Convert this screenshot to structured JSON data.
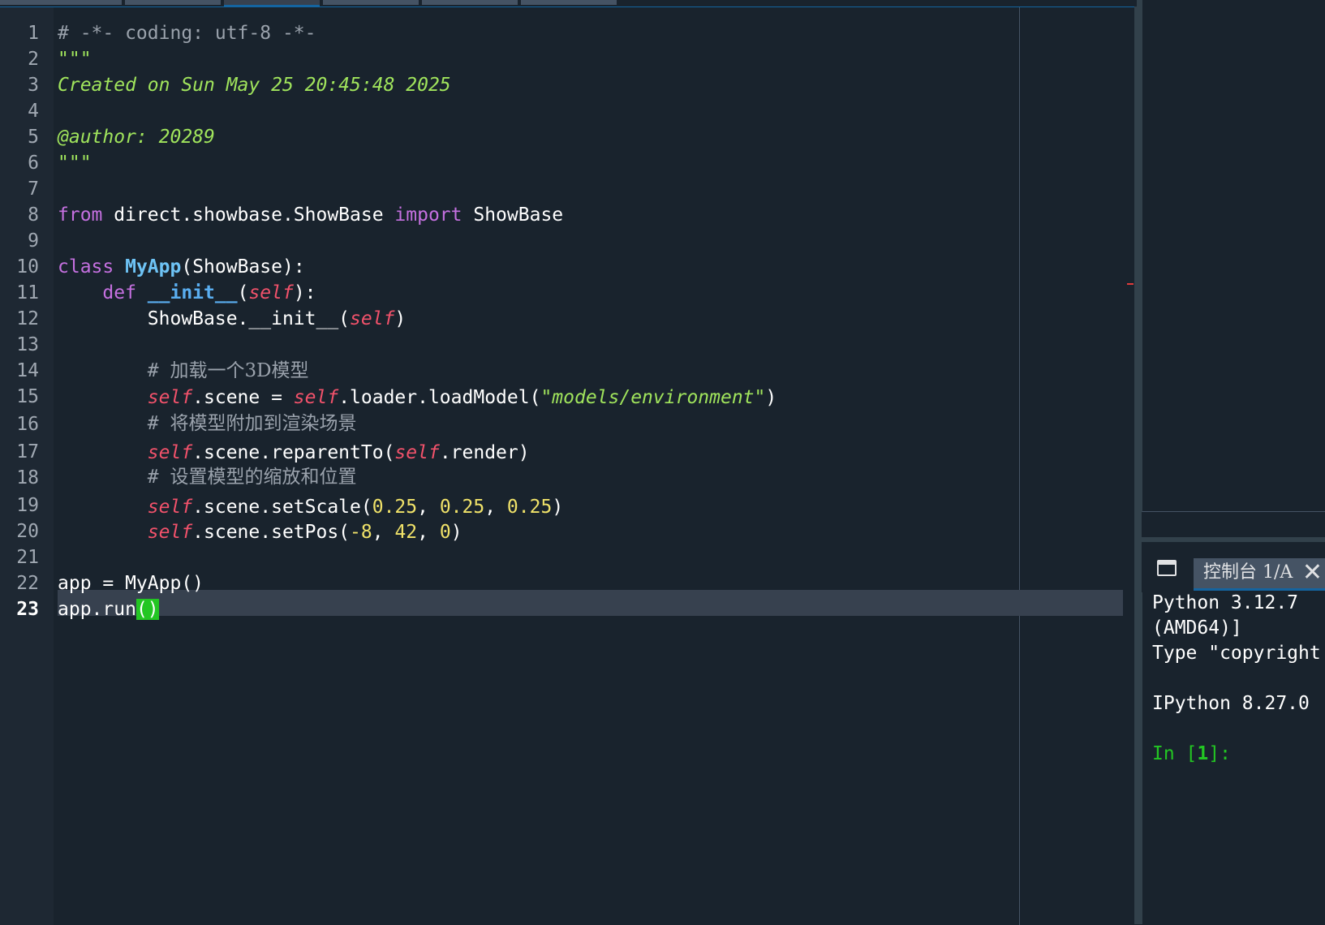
{
  "editor": {
    "current_line": 23,
    "line_numbers": [
      "1",
      "2",
      "3",
      "4",
      "5",
      "6",
      "7",
      "8",
      "9",
      "10",
      "11",
      "12",
      "13",
      "14",
      "15",
      "16",
      "17",
      "18",
      "19",
      "20",
      "21",
      "22",
      "23"
    ],
    "lines": {
      "l1": "# -*- coding: utf-8 -*-",
      "l2": "\"\"\"",
      "l3": "Created on Sun May 25 20:45:48 2025",
      "l4": "",
      "l5": "@author: 20289",
      "l6": "\"\"\"",
      "l8_kw_from": "from",
      "l8_module": " direct.showbase.ShowBase ",
      "l8_kw_import": "import",
      "l8_name": " ShowBase",
      "l10_kw": "class",
      "l10_sp": " ",
      "l10_name": "MyApp",
      "l10_rest": "(ShowBase):",
      "l11_indent": "    ",
      "l11_kw": "def",
      "l11_sp": " ",
      "l11_fn": "__init__",
      "l11_open": "(",
      "l11_self": "self",
      "l11_close": "):",
      "l12_pre": "        ShowBase.__init__(",
      "l12_self": "self",
      "l12_close": ")",
      "l14_hash": "        # ",
      "l14_text": "加载一个3D模型",
      "l15_indent": "        ",
      "l15_self1": "self",
      "l15_mid": ".scene = ",
      "l15_self2": "self",
      "l15_call": ".loader.loadModel(",
      "l15_str": "\"models/environment\"",
      "l15_close": ")",
      "l16_hash": "        # ",
      "l16_text": "将模型附加到渲染场景",
      "l17_indent": "        ",
      "l17_self1": "self",
      "l17_mid": ".scene.reparentTo(",
      "l17_self2": "self",
      "l17_close": ".render)",
      "l18_hash": "        # ",
      "l18_text": "设置模型的缩放和位置",
      "l19_indent": "        ",
      "l19_self": "self",
      "l19_call": ".scene.setScale(",
      "l19_n1": "0.25",
      "l19_c1": ", ",
      "l19_n2": "0.25",
      "l19_c2": ", ",
      "l19_n3": "0.25",
      "l19_close": ")",
      "l20_indent": "        ",
      "l20_self": "self",
      "l20_call": ".scene.setPos(",
      "l20_n1": "-8",
      "l20_c1": ", ",
      "l20_n2": "42",
      "l20_c2": ", ",
      "l20_n3": "0",
      "l20_close": ")",
      "l22": "app = MyApp()",
      "l23_pre": "app.run",
      "l23_brackets": "()"
    }
  },
  "console": {
    "tab_label": "控制台 1/A",
    "close_glyph": "✕",
    "output": {
      "line1": "Python 3.12.7",
      "line2": "(AMD64)]",
      "line3": "Type \"copyright",
      "line4": "IPython 8.27.0",
      "prompt_in": "In [",
      "prompt_num": "1",
      "prompt_end": "]:"
    }
  },
  "icons": {
    "undock": "window-icon",
    "close": "close-icon"
  },
  "colors": {
    "background": "#19232d",
    "accent": "#1464a0",
    "keyword": "#c570e0",
    "self": "#f2526b",
    "string": "#a0e45c",
    "number": "#f0e269",
    "comment": "#9aa2ac",
    "bracket_match": "#23c623"
  }
}
